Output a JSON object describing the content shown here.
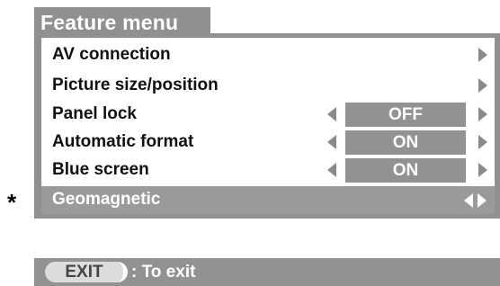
{
  "menu": {
    "title": "Feature menu",
    "items": [
      {
        "label": "AV connection"
      },
      {
        "label": "Picture size/position"
      },
      {
        "label": "Panel lock",
        "value": "OFF"
      },
      {
        "label": "Automatic format",
        "value": "ON"
      },
      {
        "label": "Blue screen",
        "value": "ON"
      },
      {
        "label": "Geomagnetic",
        "selected": true
      }
    ],
    "selected_marker": "*"
  },
  "footer": {
    "button_label": "EXIT",
    "hint": ": To exit"
  }
}
